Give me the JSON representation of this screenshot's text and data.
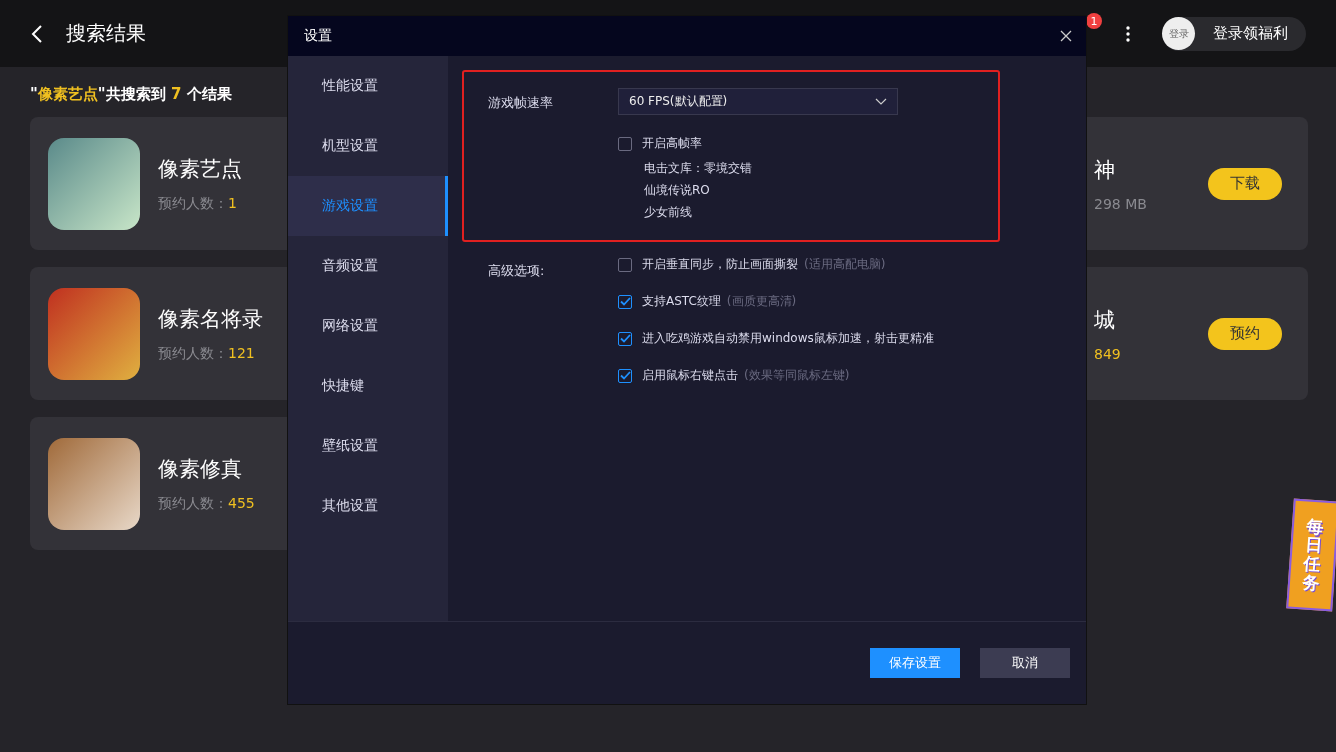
{
  "header": {
    "title": "搜索结果",
    "badge": "1",
    "login_avatar": "登录",
    "login_label": "登录领福利"
  },
  "results_summary": {
    "query": "像素艺点",
    "prefix": "\"",
    "middle": "\"共搜索到 ",
    "count": "7",
    "suffix": " 个结果"
  },
  "result_rows": [
    {
      "left": {
        "name": "像素艺点",
        "meta_label": "预约人数：",
        "meta_value": "1"
      },
      "right": {
        "name": "神",
        "meta_value": "298 MB",
        "color": "#8a8a90",
        "button": "下载"
      }
    },
    {
      "left": {
        "name": "像素名将录",
        "meta_label": "预约人数：",
        "meta_value": "121"
      },
      "right": {
        "name": "城",
        "meta_value": "849",
        "color": "#f0c020",
        "button": "预约"
      }
    },
    {
      "left": {
        "name": "像素修真",
        "meta_label": "预约人数：",
        "meta_value": "455"
      }
    }
  ],
  "daily_task_banner": "每日任务",
  "dialog": {
    "title": "设置",
    "sidebar": {
      "items": [
        {
          "label": "性能设置",
          "selected": false
        },
        {
          "label": "机型设置",
          "selected": false
        },
        {
          "label": "游戏设置",
          "selected": true
        },
        {
          "label": "音频设置",
          "selected": false
        },
        {
          "label": "网络设置",
          "selected": false
        },
        {
          "label": "快捷键",
          "selected": false
        },
        {
          "label": "壁纸设置",
          "selected": false
        },
        {
          "label": "其他设置",
          "selected": false
        }
      ]
    },
    "frame_rate": {
      "label": "游戏帧速率",
      "value": "60 FPS(默认配置)",
      "high_frame_rate": {
        "label": "开启高帧率",
        "checked": false
      },
      "supported_games": [
        "电击文库：零境交错",
        "仙境传说RO",
        "少女前线"
      ]
    },
    "advanced": {
      "label": "高级选项:",
      "options": [
        {
          "label": "开启垂直同步，防止画面撕裂",
          "hint": "(适用高配电脑)",
          "checked": false
        },
        {
          "label": "支持ASTC纹理",
          "hint": "(画质更高清)",
          "checked": true
        },
        {
          "label": "进入吃鸡游戏自动禁用windows鼠标加速，射击更精准",
          "checked": true
        },
        {
          "label": "启用鼠标右键点击",
          "hint": "(效果等同鼠标左键)",
          "checked": true
        }
      ]
    },
    "buttons": [
      {
        "label": "保存设置",
        "kind": "primary"
      },
      {
        "label": "取消",
        "kind": "secondary"
      }
    ]
  }
}
